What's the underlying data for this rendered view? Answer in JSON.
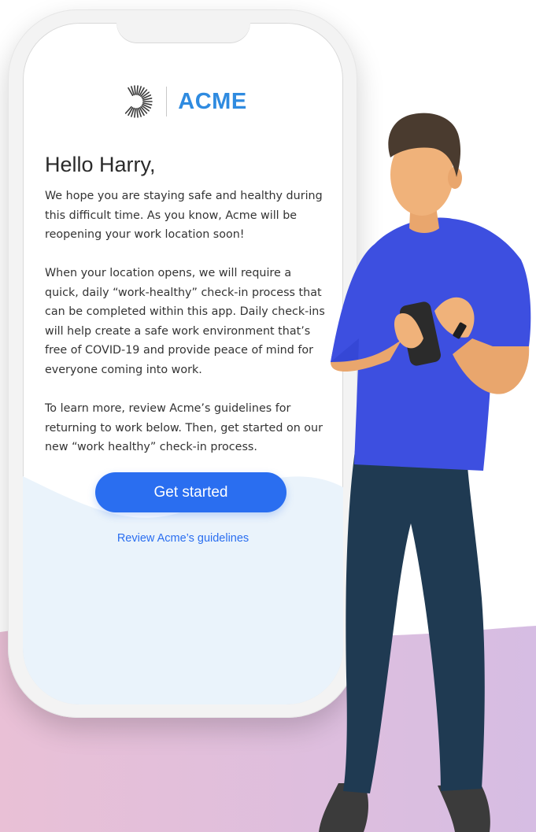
{
  "brand": {
    "name": "ACME",
    "logo_icon": "sunburst-logo-icon",
    "color": "#2f8be0"
  },
  "screen": {
    "greeting": "Hello Harry,",
    "paragraphs": [
      "We hope you are staying safe and healthy during this difficult time. As you know, Acme will be reopening your work location soon!",
      "When your location opens, we will require a quick, daily “work-healthy” check-in process that can be completed within this app. Daily check-ins will help create a safe work environment that’s free of COVID-19 and provide peace of mind for everyone coming into work.",
      "To learn more, review Acme’s guidelines for returning to work below. Then, get started on our new “work healthy” check-in process."
    ],
    "primary_button": "Get started",
    "secondary_link": "Review Acme’s guidelines"
  },
  "colors": {
    "accent": "#2a6ef0",
    "wave": "#eaf3fb",
    "floor_left": "#e8bfd7",
    "floor_right": "#d7bde4",
    "shirt": "#3d4fe0",
    "pants": "#1f3a52",
    "skin": "#f0b27a",
    "hair": "#4a3b2f"
  }
}
